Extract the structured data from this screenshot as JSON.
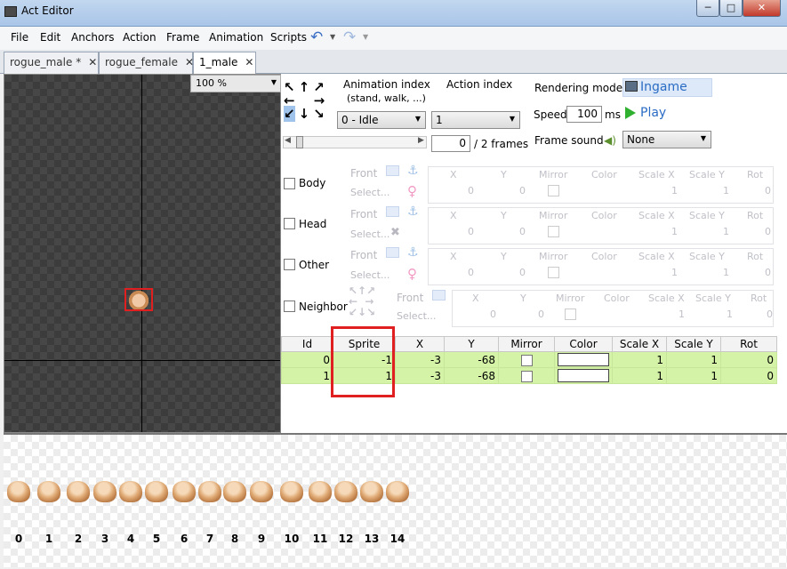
{
  "window": {
    "title": "Act Editor",
    "controls": {
      "minimize": "─",
      "maximize": "□",
      "close": "✕"
    }
  },
  "menu": [
    "File",
    "Edit",
    "Anchors",
    "Action",
    "Frame",
    "Animation",
    "Scripts"
  ],
  "tabs": [
    {
      "label": "rogue_male *",
      "close": "✕"
    },
    {
      "label": "rogue_female",
      "close": "✕"
    },
    {
      "label": "1_male",
      "close": "✕",
      "active": true
    }
  ],
  "canvas": {
    "zoom": "100 %"
  },
  "controls": {
    "animation_index_label": "Animation index",
    "animation_index_hint": "(stand, walk, ...)",
    "animation_index_value": "0 - Idle",
    "action_index_label": "Action index",
    "action_index_value": "1",
    "frame_value": "0",
    "frame_total": "/ 2 frames",
    "rendering_mode_label": "Rendering mode",
    "rendering_mode_value": "Ingame",
    "speed_label": "Speed",
    "speed_value": "100",
    "speed_unit": "ms",
    "play_label": "Play",
    "frame_sound_label": "Frame sound",
    "frame_sound_value": "None"
  },
  "anchors": [
    {
      "label": "Body",
      "front": "Front",
      "select": "Select...",
      "x": "0",
      "y": "0",
      "scale_x": "1",
      "scale_y": "1",
      "rot": "0"
    },
    {
      "label": "Head",
      "front": "Front",
      "select": "Select...",
      "x": "0",
      "y": "0",
      "scale_x": "1",
      "scale_y": "1",
      "rot": "0"
    },
    {
      "label": "Other",
      "front": "Front",
      "select": "Select...",
      "x": "0",
      "y": "0",
      "scale_x": "1",
      "scale_y": "1",
      "rot": "0"
    },
    {
      "label": "Neighbor",
      "front": "Front",
      "select": "Select...",
      "x": "0",
      "y": "0",
      "scale_x": "1",
      "scale_y": "1",
      "rot": "0"
    }
  ],
  "anchor_headers": [
    "X",
    "Y",
    "Mirror",
    "Color",
    "Scale X",
    "Scale Y",
    "Rot"
  ],
  "layers": {
    "headers": [
      "Id",
      "Sprite",
      "X",
      "Y",
      "Mirror",
      "Color",
      "Scale X",
      "Scale Y",
      "Rot"
    ],
    "rows": [
      {
        "id": "0",
        "sprite": "-1",
        "x": "-3",
        "y": "-68",
        "scale_x": "1",
        "scale_y": "1",
        "rot": "0"
      },
      {
        "id": "1",
        "sprite": "1",
        "x": "-3",
        "y": "-68",
        "scale_x": "1",
        "scale_y": "1",
        "rot": "0"
      }
    ]
  },
  "sprites": [
    "0",
    "1",
    "2",
    "3",
    "4",
    "5",
    "6",
    "7",
    "8",
    "9",
    "10",
    "11",
    "12",
    "13",
    "14"
  ]
}
